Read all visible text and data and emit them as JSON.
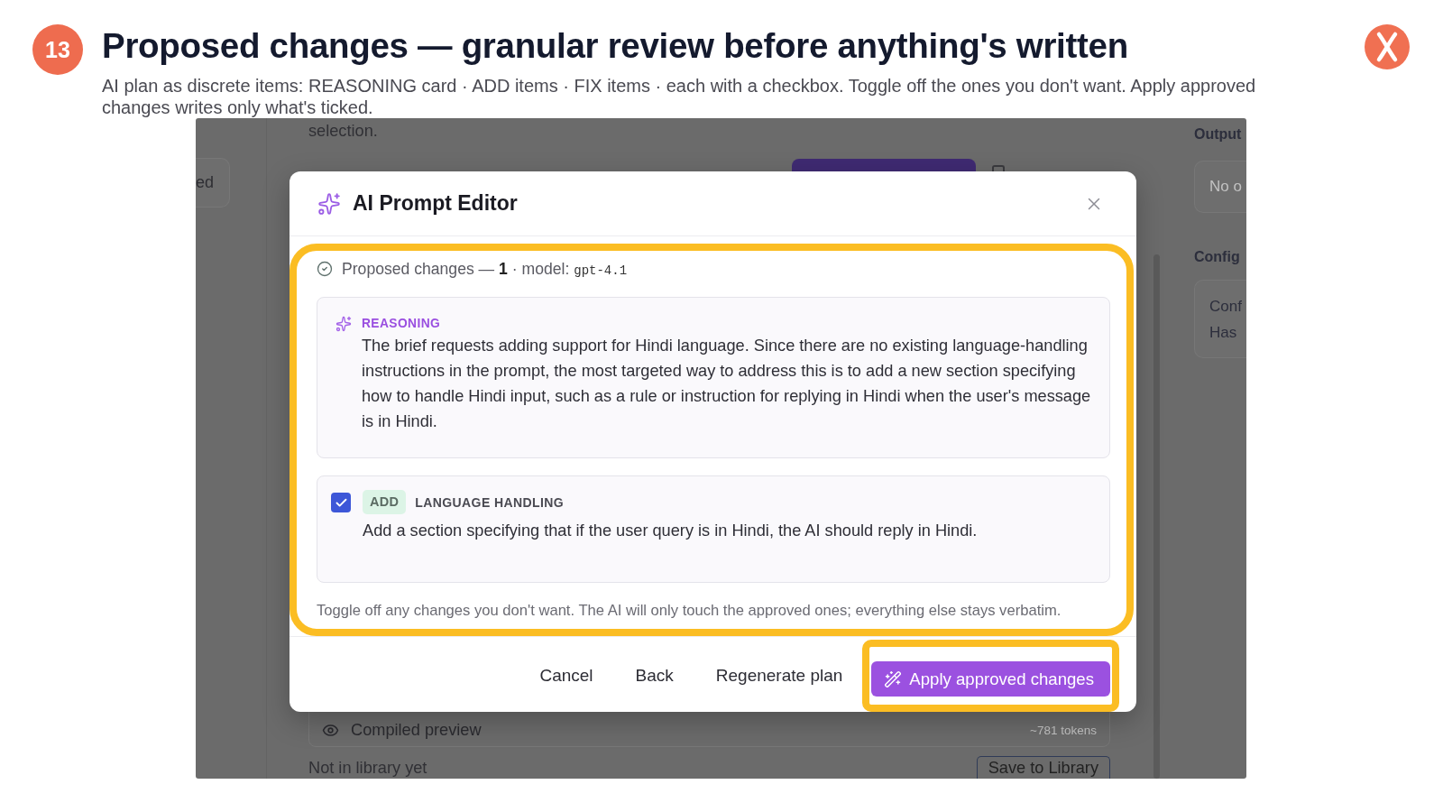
{
  "slide": {
    "number": "13",
    "title": "Proposed changes — granular review before anything's written",
    "subtitle": "AI plan as discrete items: REASONING card · ADD items · FIX items · each with a checkbox. Toggle off the ones you don't want. Apply approved changes writes only what's ticked."
  },
  "app": {
    "sidebar_card": "ed",
    "main_text": "selection.",
    "preview": {
      "label": "Compiled preview",
      "tokens": "~781 tokens"
    },
    "library_status": "Not in library yet",
    "save_button": "Save to Library",
    "output": {
      "heading": "Output",
      "field": "No o"
    },
    "config": {
      "heading": "Config",
      "lines": [
        "Conf",
        "Has"
      ]
    }
  },
  "dialog": {
    "title": "AI Prompt Editor",
    "proposal": {
      "highlighted": true,
      "summary": "Proposed changes — **1** · model: ",
      "model": "gpt-4.1",
      "items": [
        {
          "kind": "reasoning",
          "label": "REASONING",
          "text": "The brief requests adding support for Hindi language. Since there are no existing language-handling instructions in the prompt, the most targeted way to address this is to add a new section specifying how to handle Hindi input, such as a rule or instruction for replying in Hindi when the user's message is in Hindi."
        },
        {
          "kind": "change",
          "checked": true,
          "action": "ADD",
          "label": "LANGUAGE HANDLING",
          "text": "Add a section specifying that if the user query is in Hindi, the AI should reply in Hindi."
        }
      ],
      "note": "Toggle off any changes you don't want. The AI will only touch the approved ones; everything else stays verbatim."
    },
    "buttons": [
      {
        "kind": "text",
        "label": "Cancel",
        "highlighted": false
      },
      {
        "kind": "text",
        "label": "Back",
        "highlighted": false
      },
      {
        "kind": "text",
        "label": "Regenerate plan",
        "highlighted": false
      },
      {
        "kind": "primary",
        "label": "Apply approved changes",
        "highlighted": true
      }
    ]
  }
}
